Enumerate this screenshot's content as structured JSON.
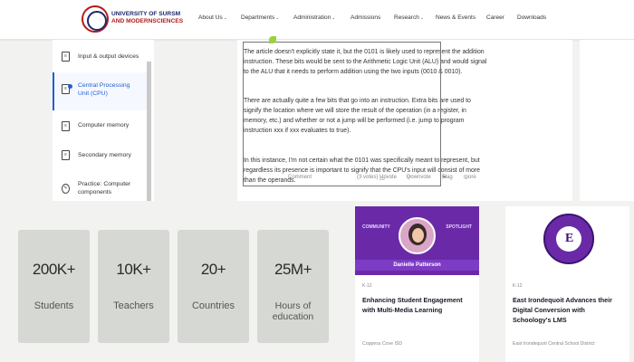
{
  "header": {
    "logo_line1": "UNIVERSITY OF SURSM",
    "logo_line2": "AND MODERNSCIENCES",
    "nav": [
      {
        "label": "About Us",
        "dropdown": true
      },
      {
        "label": "Departments",
        "dropdown": true
      },
      {
        "label": "Administration",
        "dropdown": true
      },
      {
        "label": "Admissions",
        "dropdown": false
      },
      {
        "label": "Research",
        "dropdown": true
      },
      {
        "label": "News & Events",
        "dropdown": false
      },
      {
        "label": "Career",
        "dropdown": false
      },
      {
        "label": "Downloads",
        "dropdown": false
      }
    ]
  },
  "sidebar": {
    "items": [
      {
        "label": "Input & output devices",
        "active": false,
        "icon": "document-icon"
      },
      {
        "label": "Central Processing Unit (CPU)",
        "active": true,
        "icon": "document-icon"
      },
      {
        "label": "Computer memory",
        "active": false,
        "icon": "document-icon"
      },
      {
        "label": "Secondary memory",
        "active": false,
        "icon": "document-icon"
      },
      {
        "label": "Practice: Computer components",
        "active": false,
        "icon": "pencil-icon"
      }
    ],
    "accent": "#1f5fd1"
  },
  "article": {
    "paragraphs": [
      "The article doesn't explicitly state it, but the 0101 is likely used to represent the addition instruction. These bits would be sent to the Arithmetic Logic Unit (ALU) and would signal to the ALU that it needs to perform addition using the two inputs (0010 & 0010).",
      "There are actually quite a few bits that go into an instruction. Extra bits are used to signify the location where we will store the result of the operation (in a register, in memory, etc.) and whether or not a jump will be performed (i.e. jump to program instruction xxx if xxx evaluates to true).",
      "In this instance, I'm not certain what the 0101 was specifically meant to represent, but regardless its presence is important to signify that the CPU's input will consist of more than the operands."
    ],
    "actions": {
      "comment": "Comment",
      "votes": "(3 votes)",
      "upvote": "Upvote",
      "downvote": "Downvote",
      "flag": "Flag",
      "more": "more"
    }
  },
  "stats": [
    {
      "number": "200K+",
      "caption": "Students"
    },
    {
      "number": "10K+",
      "caption": "Teachers"
    },
    {
      "number": "20+",
      "caption": "Countries"
    },
    {
      "number": "25M+",
      "caption": "Hours of education"
    }
  ],
  "cards": [
    {
      "banner_left": "COMMUNITY",
      "banner_right": "SPOTLIGHT",
      "person": "Danielle Patterson",
      "tag": "K-12",
      "title": "Enhancing Student Engagement with Multi-Media Learning",
      "source": "Coppess Cove ISD"
    },
    {
      "tag": "K-12",
      "title": "East Irondequoit Advances their Digital Conversion with Schoology's LMS",
      "source": "East Irondequoit Central School District"
    }
  ]
}
